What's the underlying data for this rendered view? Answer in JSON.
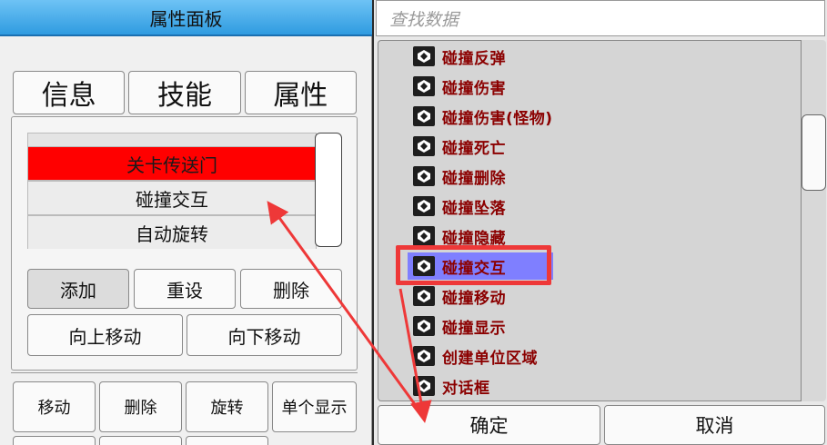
{
  "left_panel": {
    "title": "属性面板",
    "tabs": [
      "信息",
      "技能",
      "属性"
    ],
    "level_items": [
      {
        "label": "关卡传送门",
        "selected": true
      },
      {
        "label": "碰撞交互",
        "selected": false
      },
      {
        "label": "自动旋转",
        "selected": false
      }
    ],
    "buttons": {
      "add": "添加",
      "reset": "重设",
      "delete": "删除",
      "move_up": "向上移动",
      "move_down": "向下移动"
    },
    "bottom_buttons": [
      "移动",
      "删除",
      "旋转",
      "单个显示"
    ]
  },
  "right_panel": {
    "search_placeholder": "查找数据",
    "items": [
      "碰撞反弹",
      "碰撞伤害",
      "碰撞伤害(怪物)",
      "碰撞死亡",
      "碰撞删除",
      "碰撞坠落",
      "碰撞隐藏",
      "碰撞交互",
      "碰撞移动",
      "碰撞显示",
      "创建单位区域",
      "对话框"
    ],
    "selected_item": "碰撞交互",
    "confirm": "确定",
    "cancel": "取消"
  },
  "colors": {
    "title_bar": "#2f9be0",
    "selected_level": "#ff0000",
    "item_text": "#8b0000",
    "selected_item_bg": "#7f7fff",
    "annotation": "#ee3838"
  }
}
